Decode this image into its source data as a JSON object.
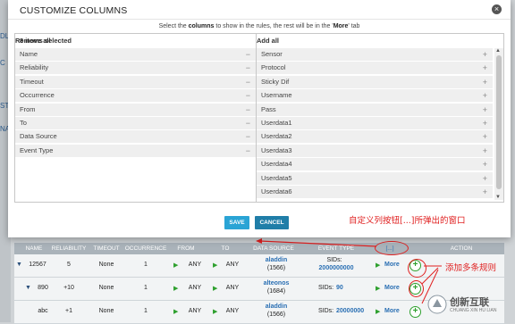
{
  "dialog": {
    "title": "CUSTOMIZE COLUMNS",
    "close_icon": "×",
    "instruction_pre": "Select the ",
    "instruction_bold1": "columns",
    "instruction_mid": " to show in the rules, the rest will be in the '",
    "instruction_bold2": "More",
    "instruction_post": "' tab",
    "selected_panel": {
      "header": "8 items selected",
      "action": "Remove all",
      "items": [
        "Name",
        "Reliability",
        "Timeout",
        "Occurrence",
        "From",
        "To",
        "Data Source",
        "Event Type"
      ],
      "item_icon": "−"
    },
    "available_panel": {
      "action": "Add all",
      "items": [
        "Sensor",
        "Protocol",
        "Sticky Dif",
        "Username",
        "Pass",
        "Userdata1",
        "Userdata2",
        "Userdata3",
        "Userdata4",
        "Userdata5",
        "Userdata6"
      ],
      "item_icon": "+"
    },
    "save_label": "SAVE",
    "cancel_label": "CANCEL",
    "save_color": "#2aa4d5",
    "cancel_color": "#207ea8"
  },
  "annotations": {
    "popup_note": "自定义列按钮[...]所弹出的窗口",
    "add_rules_note": "添加多条规则",
    "color": "#e02020"
  },
  "table": {
    "headers": [
      "NAME",
      "RELIABILITY",
      "TIMEOUT",
      "OCCURRENCE",
      "FROM",
      "TO",
      "DATA SOURCE",
      "EVENT TYPE",
      "[...]",
      "ACTION"
    ],
    "rows": [
      {
        "name": "12567",
        "reliability": "5",
        "timeout": "None",
        "occurrence": "1",
        "from": "ANY",
        "to": "ANY",
        "ds_name": "aladdin",
        "ds_id": "(1566)",
        "sids_label": "SIDs:",
        "sids": "2000000000",
        "more": "More",
        "plus": "+"
      },
      {
        "name": "890",
        "reliability": "+10",
        "timeout": "None",
        "occurrence": "1",
        "from": "ANY",
        "to": "ANY",
        "ds_name": "alteonos",
        "ds_id": "(1684)",
        "sids_label": "SIDs:",
        "sids": "90",
        "more": "More",
        "plus": "+"
      },
      {
        "name": "abc",
        "reliability": "+1",
        "timeout": "None",
        "occurrence": "1",
        "from": "ANY",
        "to": "ANY",
        "ds_name": "aladdin",
        "ds_id": "(1566)",
        "sids_label": "SIDs:",
        "sids": "20000000",
        "more": "More",
        "plus": "+"
      }
    ],
    "triangle": "▼",
    "arrow": "▶"
  },
  "left_stub": [
    "DL",
    "C",
    "ST",
    "NAME"
  ],
  "watermark": {
    "name": "创新互联",
    "sub": "CHUANG XIN HU LIAN"
  }
}
